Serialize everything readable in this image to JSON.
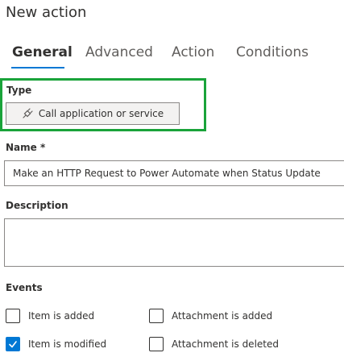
{
  "dialog": {
    "title": "New action"
  },
  "tabs": [
    {
      "label": "General",
      "active": true
    },
    {
      "label": "Advanced",
      "active": false
    },
    {
      "label": "Action",
      "active": false
    },
    {
      "label": "Conditions",
      "active": false
    }
  ],
  "type_field": {
    "label": "Type",
    "button_label": "Call application or service",
    "icon": "plug-icon",
    "highlight_color": "#1aa33a"
  },
  "name_field": {
    "label": "Name *",
    "value": "Make an HTTP Request to Power Automate when Status Update"
  },
  "description_field": {
    "label": "Description",
    "value": ""
  },
  "events": {
    "label": "Events",
    "options": [
      {
        "label": "Item is added",
        "checked": false
      },
      {
        "label": "Attachment is added",
        "checked": false
      },
      {
        "label": "Item is modified",
        "checked": true
      },
      {
        "label": "Attachment is deleted",
        "checked": false
      }
    ]
  },
  "colors": {
    "accent": "#0078d4",
    "text": "#323130",
    "border": "#8a8886"
  }
}
